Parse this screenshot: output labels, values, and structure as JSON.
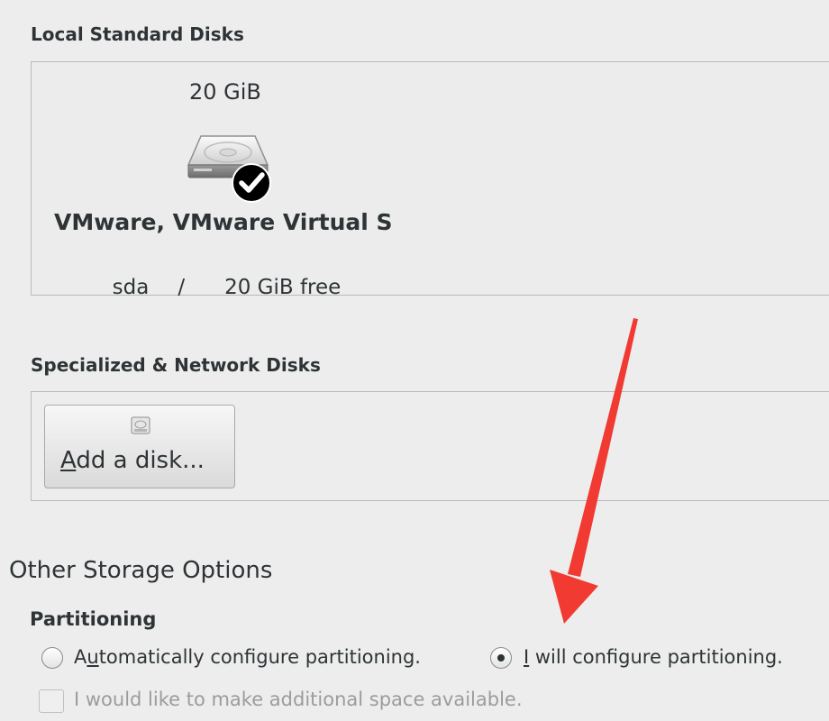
{
  "local_disks": {
    "section_label": "Local Standard Disks",
    "disk": {
      "size": "20 GiB",
      "name": "VMware, VMware Virtual S",
      "device": "sda",
      "separator": "/",
      "free": "20 GiB free",
      "selected": true
    }
  },
  "network_disks": {
    "section_label": "Specialized & Network Disks",
    "add_button_mnemonic": "A",
    "add_button_rest": "dd a disk..."
  },
  "other_storage": {
    "title": "Other Storage Options",
    "partitioning_label": "Partitioning",
    "auto_option": {
      "pre": "A",
      "mnemonic": "u",
      "post": "tomatically configure partitioning.",
      "checked": false
    },
    "manual_option": {
      "mnemonic": "I",
      "post": " will configure partitioning.",
      "checked": true
    },
    "reclaim_option": {
      "label": "I would like to make additional space available.",
      "checked": false,
      "disabled": true
    }
  },
  "colors": {
    "background": "#ededed",
    "text": "#2e3436",
    "annotation_arrow": "#f03a32"
  }
}
